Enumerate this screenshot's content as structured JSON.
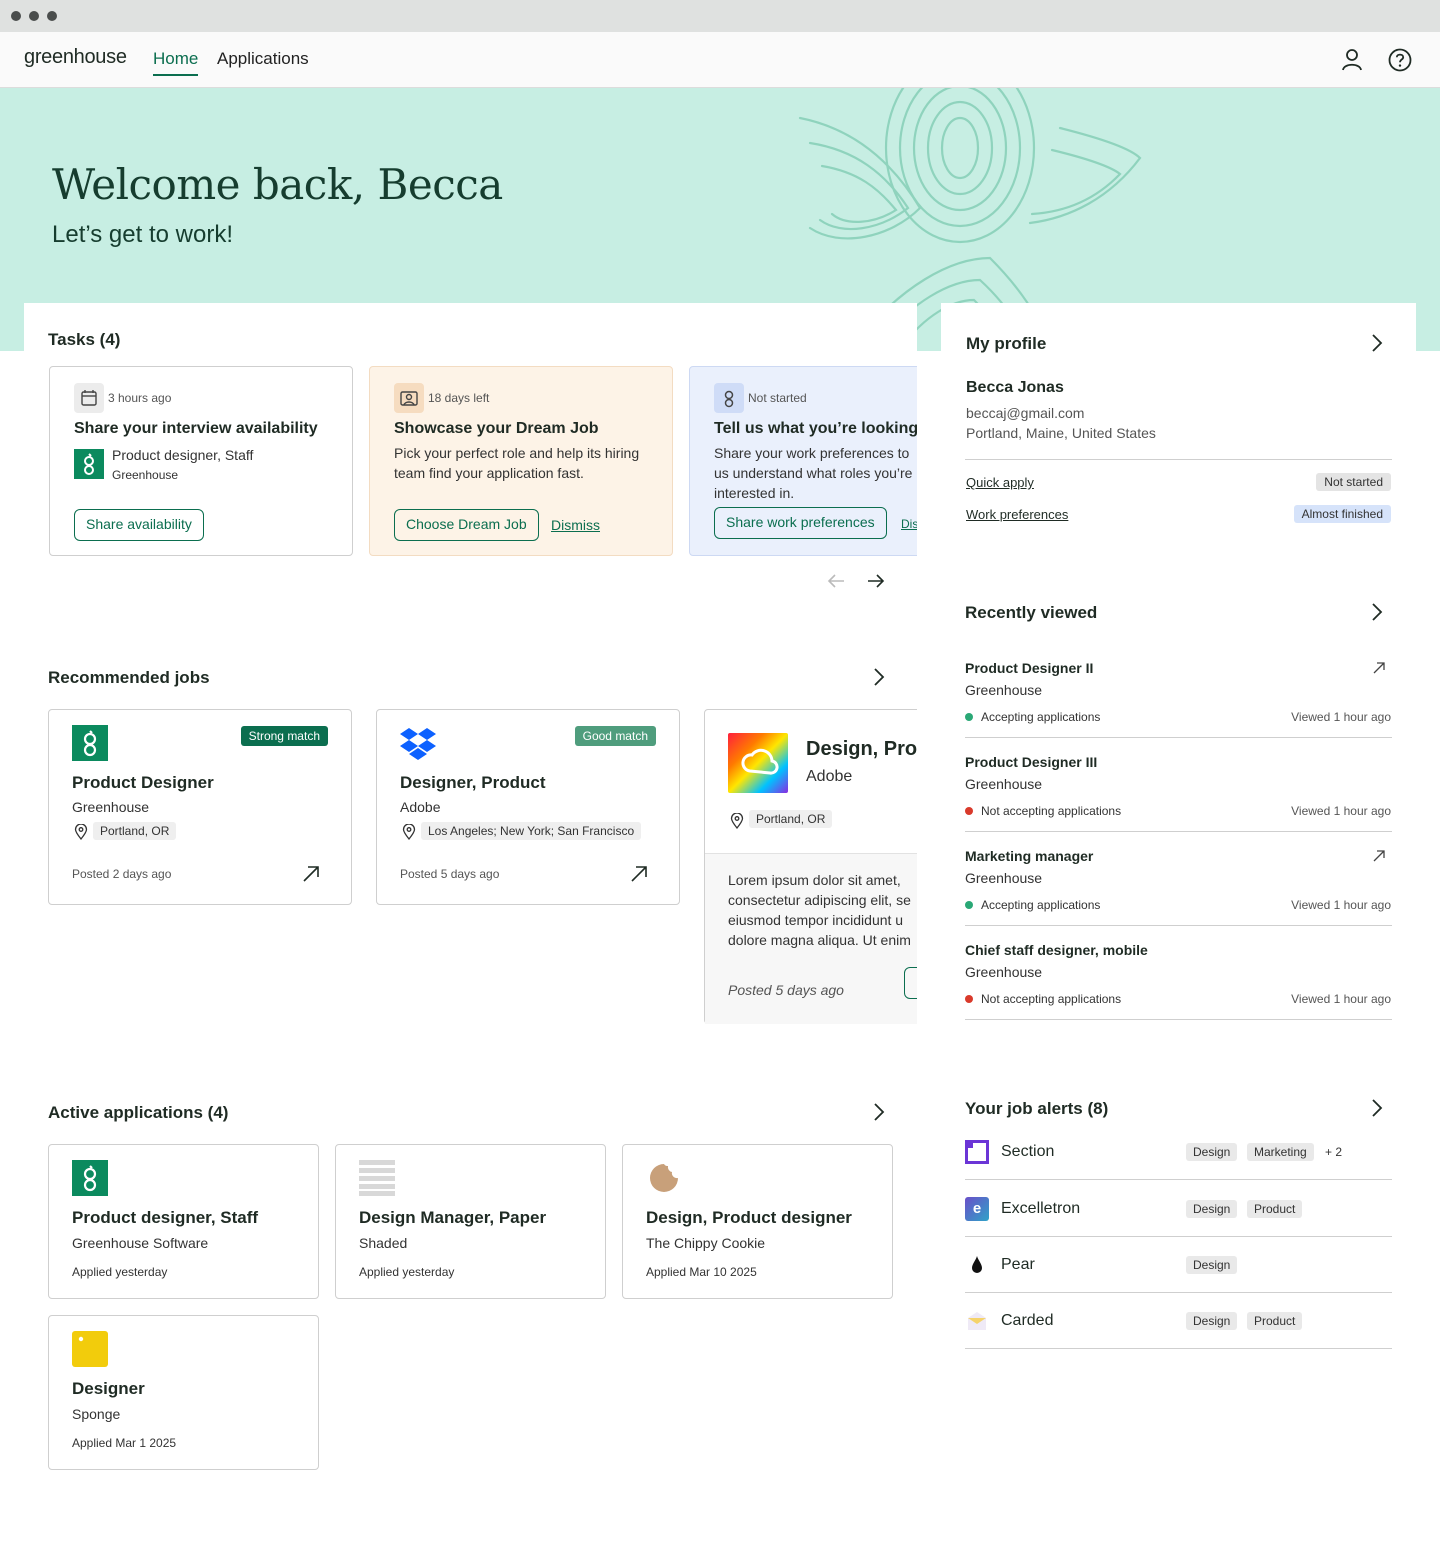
{
  "nav": {
    "logo": "greenhouse",
    "links": [
      {
        "label": "Home",
        "active": true
      },
      {
        "label": "Applications",
        "active": false
      }
    ],
    "icons": [
      "user-icon",
      "help-icon"
    ]
  },
  "hero": {
    "title": "Welcome back, Becca",
    "subtitle": "Let’s get to work!"
  },
  "tasks": {
    "heading": "Tasks (4)",
    "items": [
      {
        "icon": "calendar-icon",
        "meta": "3 hours ago",
        "title": "Share your interview availability",
        "job": "Product designer, Staff",
        "company": "Greenhouse",
        "action": "Share availability"
      },
      {
        "icon": "picture-icon",
        "meta": "18 days left",
        "title": "Showcase your Dream Job",
        "body": "Pick your perfect role and help its hiring team find your application fast.",
        "action": "Choose Dream Job",
        "dismiss": "Dismiss"
      },
      {
        "icon": "greenhouse-g-icon",
        "meta": "Not started",
        "title": "Tell us what you’re looking",
        "body": "Share your work preferences to us understand what roles you’re interested in.",
        "action": "Share work preferences",
        "dismiss": "Dis"
      }
    ],
    "pager": [
      "arrow-left-icon",
      "arrow-right-icon"
    ]
  },
  "recommended": {
    "heading": "Recommended jobs",
    "jobs": [
      {
        "title": "Product Designer",
        "company": "Greenhouse",
        "location": "Portland, OR",
        "badge": "Strong match",
        "posted": "Posted 2 days ago",
        "logo": "greenhouse-logo"
      },
      {
        "title": "Designer, Product",
        "company": "Adobe",
        "location": "Los Angeles; New York; San Francisco",
        "badge": "Good match",
        "posted": "Posted 5 days ago",
        "logo": "dropbox-logo"
      },
      {
        "title": "Design, Pro",
        "company": "Adobe",
        "location": "Portland, OR",
        "description": "Lorem ipsum dolor sit amet, consectetur adipiscing elit, se eiusmod tempor incididunt u dolore magna aliqua. Ut enim",
        "posted": "Posted 5 days ago",
        "logo": "creative-cloud-logo"
      }
    ]
  },
  "applications": {
    "heading": "Active applications (4)",
    "items": [
      {
        "title": "Product designer, Staff",
        "company": "Greenhouse Software",
        "date": "Applied yesterday",
        "logo": "greenhouse-logo"
      },
      {
        "title": "Design Manager, Paper",
        "company": "Shaded",
        "date": "Applied yesterday",
        "logo": "shaded-logo"
      },
      {
        "title": "Design, Product designer",
        "company": "The Chippy Cookie",
        "date": "Applied Mar 10 2025",
        "logo": "cookie-logo"
      },
      {
        "title": "Designer",
        "company": "Sponge",
        "date": "Applied Mar 1 2025",
        "logo": "sponge-logo"
      }
    ]
  },
  "profile": {
    "heading": "My profile",
    "name": "Becca Jonas",
    "email": "beccaj@gmail.com",
    "location": "Portland, Maine, United States",
    "links": [
      {
        "label": "Quick apply",
        "status": "Not started",
        "status_color": "#e4e4e4"
      },
      {
        "label": "Work preferences",
        "status": "Almost finished",
        "status_color": "#d6e3fa"
      }
    ]
  },
  "recently_viewed": {
    "heading": "Recently viewed",
    "items": [
      {
        "title": "Product Designer II",
        "company": "Greenhouse",
        "status": "Accepting applications",
        "accepting": true,
        "viewed": "Viewed 1 hour ago"
      },
      {
        "title": "Product Designer III",
        "company": "Greenhouse",
        "status": "Not accepting applications",
        "accepting": false,
        "viewed": "Viewed 1 hour ago"
      },
      {
        "title": "Marketing manager",
        "company": "Greenhouse",
        "status": "Accepting applications",
        "accepting": true,
        "viewed": "Viewed 1 hour ago"
      },
      {
        "title": "Chief staff designer, mobile",
        "company": "Greenhouse",
        "status": "Not accepting applications",
        "accepting": false,
        "viewed": "Viewed 1 hour ago"
      }
    ]
  },
  "job_alerts": {
    "heading": "Your job alerts (8)",
    "items": [
      {
        "name": "Section",
        "tags": [
          "Design",
          "Marketing"
        ],
        "more": "+ 2",
        "logo": "section-logo"
      },
      {
        "name": "Excelletron",
        "tags": [
          "Design",
          "Product"
        ],
        "logo": "excelletron-logo"
      },
      {
        "name": "Pear",
        "tags": [
          "Design"
        ],
        "logo": "pear-logo"
      },
      {
        "name": "Carded",
        "tags": [
          "Design",
          "Product"
        ],
        "logo": "carded-logo"
      }
    ]
  },
  "colors": {
    "brand": "#0b6e4f",
    "hero_bg": "#c7eee3",
    "strong_match": "#0b6e4f",
    "good_match": "#4f9d7d",
    "accepting": "#2aa876",
    "not_accepting": "#d93a2b"
  }
}
